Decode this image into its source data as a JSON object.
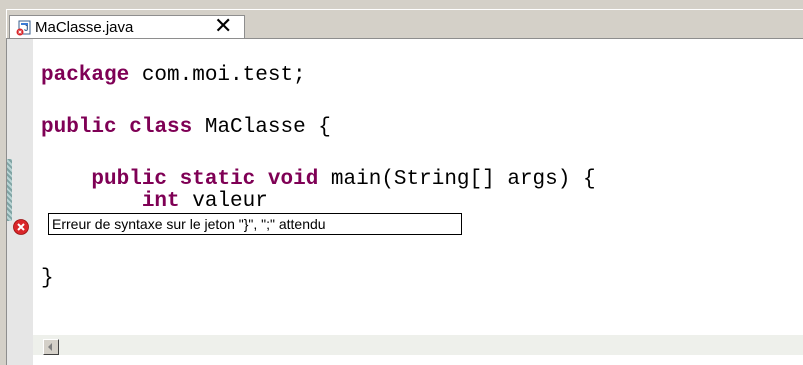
{
  "tab": {
    "label": "MaClasse.java",
    "close_glyph": "✕"
  },
  "code": {
    "lines": [
      "package com.moi.test;",
      "",
      "public class MaClasse {",
      "",
      "    public static void main(String[] args) {",
      "        int valeur",
      "",
      "",
      "}"
    ]
  },
  "error": {
    "message": "Erreur de syntaxe sur le jeton \"}\", \";\" attendu",
    "icon": "error-icon"
  },
  "colors": {
    "keyword": "#7f0055",
    "error": "#d9262a"
  }
}
